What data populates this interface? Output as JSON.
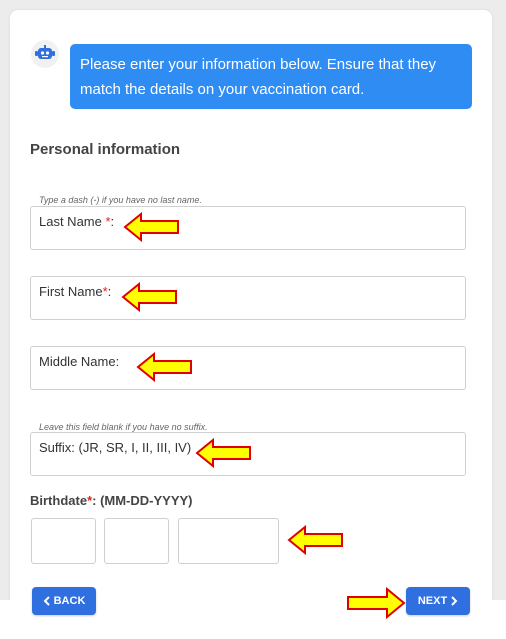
{
  "chat": {
    "bot_icon": "robot-icon",
    "message": "Please enter your information below. Ensure that they match the details on your vaccination card."
  },
  "section": {
    "title": "Personal information"
  },
  "fields": {
    "last_name": {
      "hint": "Type a dash (-) if you have no last name.",
      "label": "Last Name ",
      "required_mark": "*",
      "suffix": ":"
    },
    "first_name": {
      "label": "First Name",
      "required_mark": "*",
      "suffix": ":"
    },
    "middle_name": {
      "label": "Middle Name:"
    },
    "name_suffix": {
      "hint": "Leave this field blank if you have no suffix.",
      "label": "Suffix: (JR, SR, I, II, III, IV)"
    }
  },
  "birthdate": {
    "label": "Birthdate",
    "required_mark": "*",
    "format": ": (MM-DD-YYYY)"
  },
  "buttons": {
    "back_label": "BACK",
    "next_label": "NEXT"
  },
  "colors": {
    "accent": "#2f8cf3",
    "button": "#2f6fe0",
    "required": "#e02020",
    "annotation_fill": "#ffff00",
    "annotation_stroke": "#e00000"
  }
}
